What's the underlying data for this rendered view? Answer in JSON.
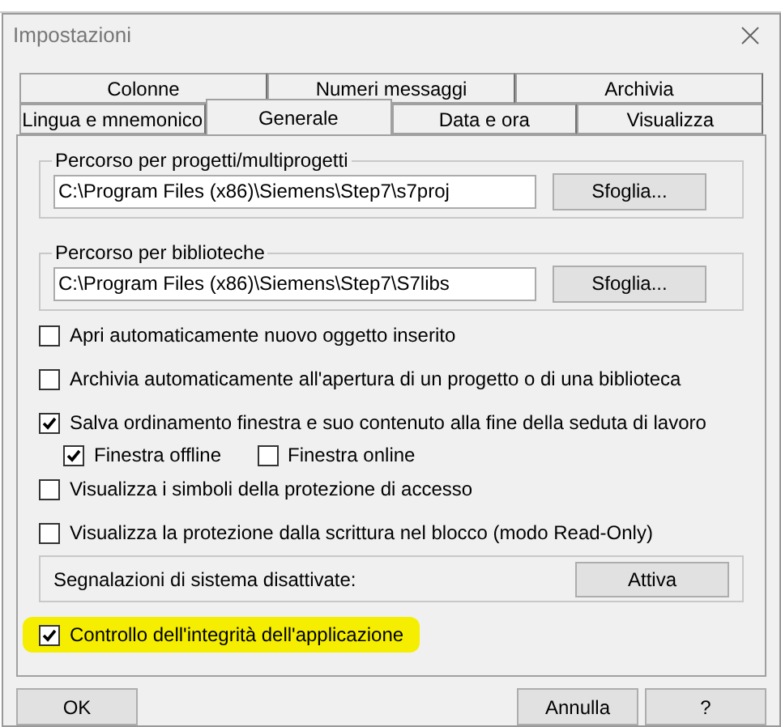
{
  "window": {
    "title": "Impostazioni"
  },
  "tab_rows": [
    {
      "tabs": [
        {
          "label": "Colonne",
          "selected": false
        },
        {
          "label": "Numeri messaggi",
          "selected": false
        },
        {
          "label": "Archivia",
          "selected": false
        }
      ]
    },
    {
      "tabs": [
        {
          "label": "Lingua e mnemonico",
          "selected": false
        },
        {
          "label": "Generale",
          "selected": true
        },
        {
          "label": "Data e ora",
          "selected": false
        },
        {
          "label": "Visualizza",
          "selected": false
        }
      ]
    }
  ],
  "path_groups": [
    {
      "label": "Percorso per progetti/multiprogetti",
      "value": "C:\\Program Files (x86)\\Siemens\\Step7\\s7proj",
      "button": "Sfoglia..."
    },
    {
      "label": "Percorso per biblioteche",
      "value": "C:\\Program Files (x86)\\Siemens\\Step7\\S7libs",
      "button": "Sfoglia..."
    }
  ],
  "options": [
    {
      "label": "Apri automaticamente nuovo oggetto inserito",
      "checked": false
    },
    {
      "label": "Archivia automaticamente all'apertura di un progetto o di una biblioteca",
      "checked": false
    },
    {
      "label": "Salva ordinamento finestra e suo contenuto alla fine della seduta di lavoro",
      "checked": true,
      "children": [
        {
          "label": "Finestra offline",
          "checked": true
        },
        {
          "label": "Finestra online",
          "checked": false
        }
      ]
    },
    {
      "label": "Visualizza i simboli della protezione di accesso",
      "checked": false
    },
    {
      "label": "Visualizza la protezione dalla scrittura nel blocco (modo Read-Only)",
      "checked": false
    }
  ],
  "system_messages": {
    "label": "Segnalazioni di sistema disattivate:",
    "button": "Attiva"
  },
  "integrity_check": {
    "label": "Controllo dell'integrità dell'applicazione",
    "checked": true,
    "highlighted": true
  },
  "buttons": [
    {
      "label": "OK"
    },
    {
      "label": "Annulla"
    },
    {
      "label": "?"
    }
  ]
}
